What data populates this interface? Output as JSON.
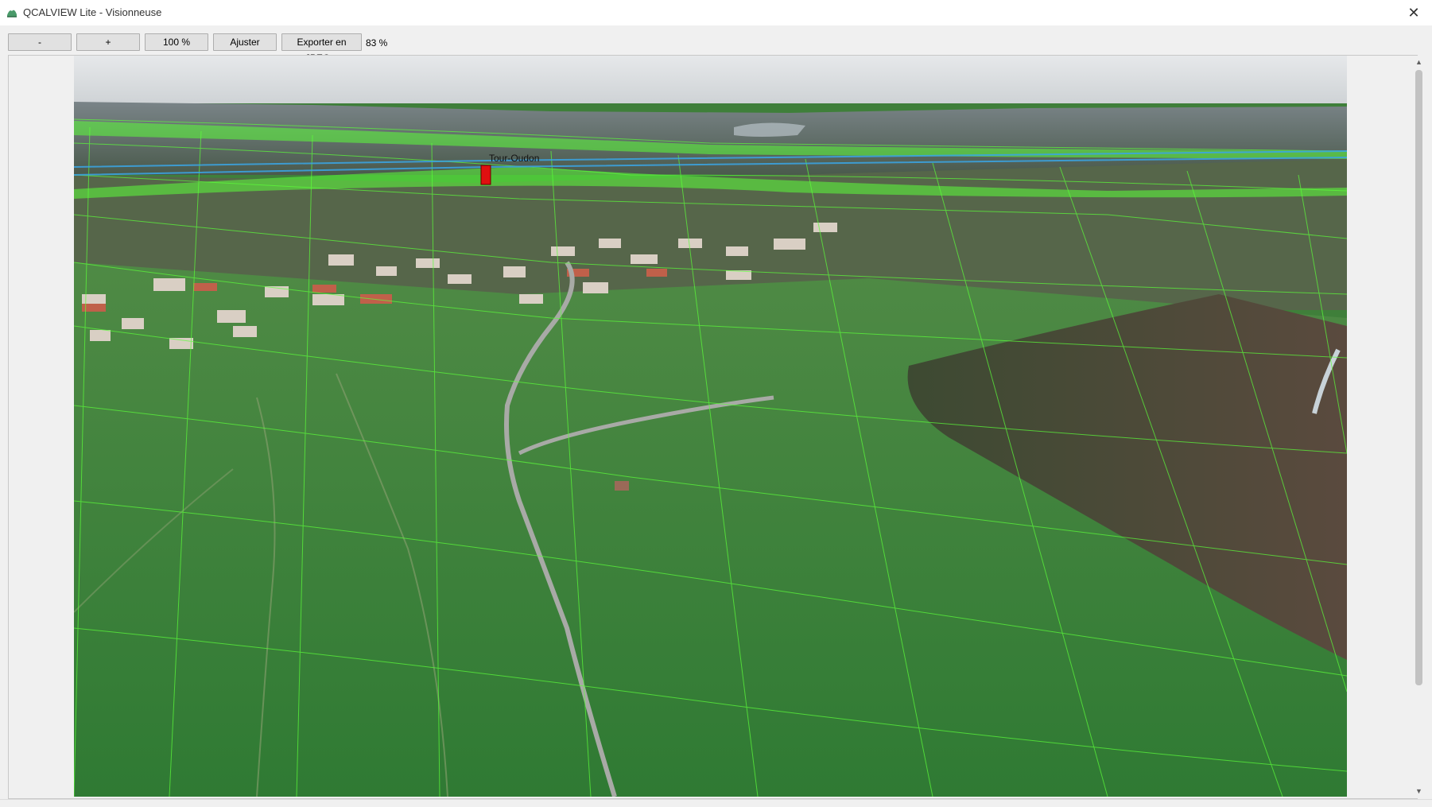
{
  "window": {
    "title": "QCALVIEW Lite - Visionneuse",
    "close_glyph": "✕",
    "app_icon": "app-logo-icon"
  },
  "toolbar": {
    "zoom_out_label": "-",
    "zoom_in_label": "+",
    "actual_size_label": "100 %",
    "fit_label": "Ajuster",
    "export_label": "Exporter en JPEG...",
    "zoom_level": "83 %"
  },
  "viewer": {
    "overlay_marker_label": "Tour-Oudon",
    "marker_color": "#e01010",
    "grid_color": "#5cff3a",
    "line_color": "#3aa6e6"
  },
  "scrollbar": {
    "up_icon": "scroll-up-arrow-icon",
    "down_icon": "scroll-down-arrow-icon"
  }
}
